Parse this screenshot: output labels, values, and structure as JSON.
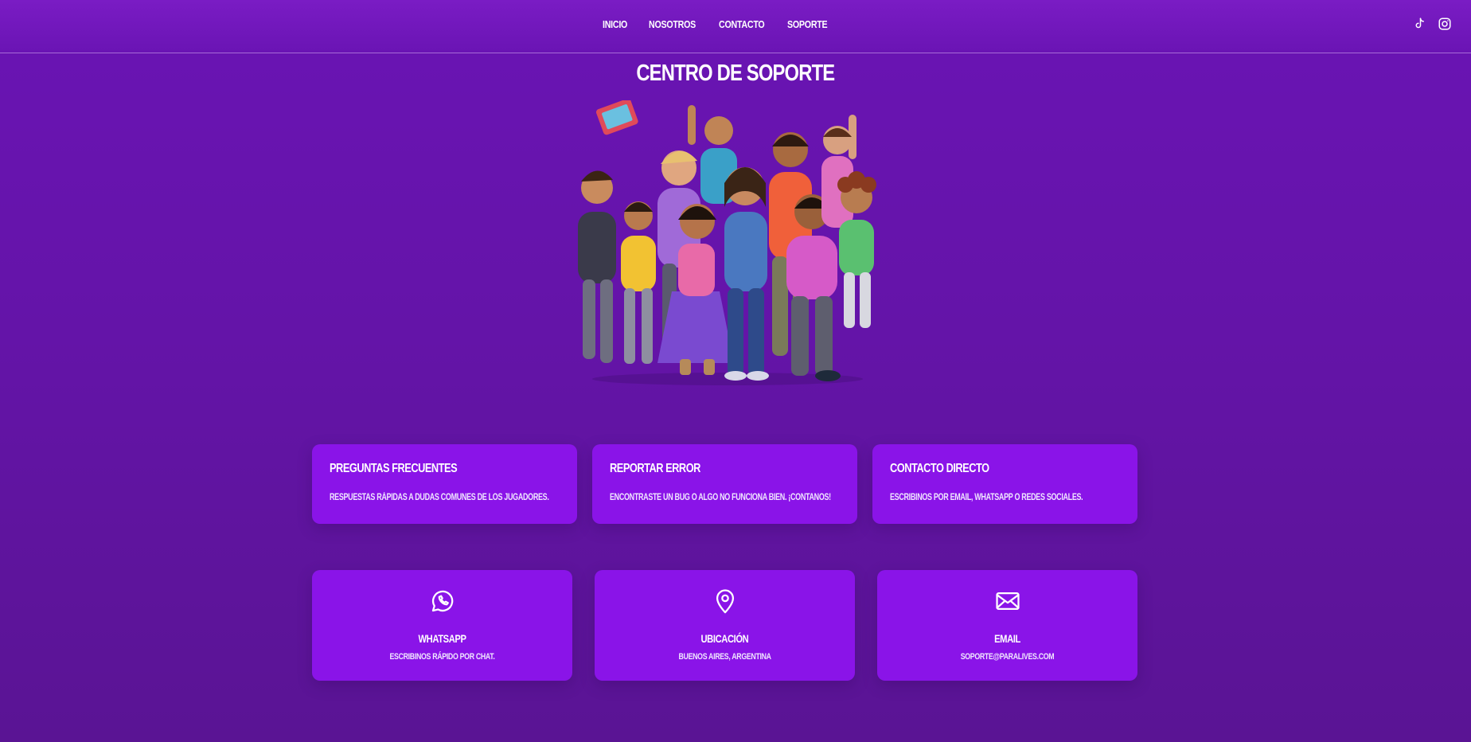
{
  "nav": {
    "items": [
      {
        "label": "INICIO"
      },
      {
        "label": "NOSOTROS"
      },
      {
        "label": "CONTACTO"
      },
      {
        "label": "SOPORTE"
      }
    ],
    "social_icons": [
      "tiktok-icon",
      "instagram-icon"
    ]
  },
  "page": {
    "title": "CENTRO DE SOPORTE",
    "hero_image": "group-of-cartoon-characters-celebrating"
  },
  "info_cards": [
    {
      "title": "PREGUNTAS FRECUENTES",
      "desc": "RESPUESTAS RÁPIDAS A DUDAS COMUNES DE LOS JUGADORES."
    },
    {
      "title": "REPORTAR ERROR",
      "desc": "ENCONTRASTE UN BUG O ALGO NO FUNCIONA BIEN. ¡CONTANOS!"
    },
    {
      "title": "CONTACTO DIRECTO",
      "desc": "ESCRIBINOS POR EMAIL, WHATSAPP O REDES SOCIALES."
    }
  ],
  "contact_cards": [
    {
      "icon": "whatsapp-icon",
      "title": "WHATSAPP",
      "desc": "ESCRIBINOS RÁPIDO POR CHAT."
    },
    {
      "icon": "location-pin-icon",
      "title": "UBICACIÓN",
      "desc": "BUENOS AIRES, ARGENTINA"
    },
    {
      "icon": "envelope-icon",
      "title": "EMAIL",
      "desc": "SOPORTE@PARALIVES.COM"
    }
  ],
  "colors": {
    "background": "#6414a8",
    "card": "#8a14e8",
    "text": "#ffffff"
  }
}
